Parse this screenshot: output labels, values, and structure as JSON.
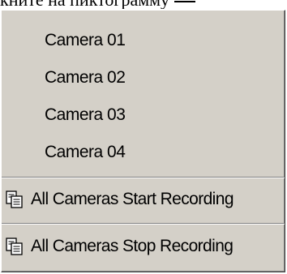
{
  "background_text": "кните на пиктограмму",
  "menu": {
    "cameras": [
      {
        "label": "Camera 01"
      },
      {
        "label": "Camera 02"
      },
      {
        "label": "Camera 03"
      },
      {
        "label": "Camera 04"
      }
    ],
    "actions": [
      {
        "label": "All Cameras Start Recording",
        "icon": "copy-documents-icon"
      },
      {
        "label": "All Cameras Stop Recording",
        "icon": "copy-documents-icon"
      }
    ]
  },
  "colors": {
    "menu_background": "#d4d0c8",
    "text": "#000000"
  }
}
